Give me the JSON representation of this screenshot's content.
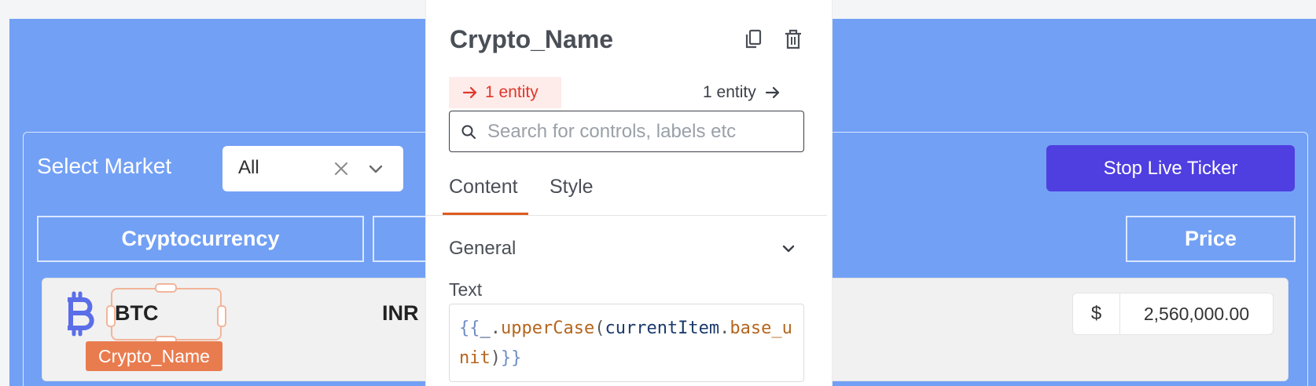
{
  "app": {
    "select_label": "Select Market",
    "select_value": "All",
    "ticker_button": "Stop Live Ticker",
    "columns": {
      "crypto": "Cryptocurrency",
      "price": "Price"
    },
    "row": {
      "symbol": "BTC",
      "market": "INR",
      "price_prefix": "$",
      "price_value": "2,560,000.00"
    },
    "widget_tag": "Crypto_Name"
  },
  "pane": {
    "title": "Crypto_Name",
    "entity_in": "1 entity",
    "entity_out": "1 entity",
    "search_placeholder": "Search for controls, labels etc",
    "tabs": [
      "Content",
      "Style"
    ],
    "section": "General",
    "text_label": "Text",
    "code": {
      "open": "{{",
      "obj": "_",
      "dot1": ".",
      "fn": "upperCase",
      "paren_open": "(",
      "arg_obj": "currentItem",
      "dot2": ".",
      "arg_prop": "base_unit",
      "paren_close": ")",
      "close": "}}"
    }
  },
  "colors": {
    "canvas": "#72a0f5",
    "button": "#4f3fe0",
    "accent": "#e05a1f",
    "widget_tag": "#e97c4f",
    "entity_in": "#e0372b"
  },
  "icons": [
    "bitcoin-icon",
    "close-icon",
    "chevron-down-icon",
    "copy-icon",
    "trash-icon",
    "arrow-right-icon",
    "search-icon"
  ]
}
